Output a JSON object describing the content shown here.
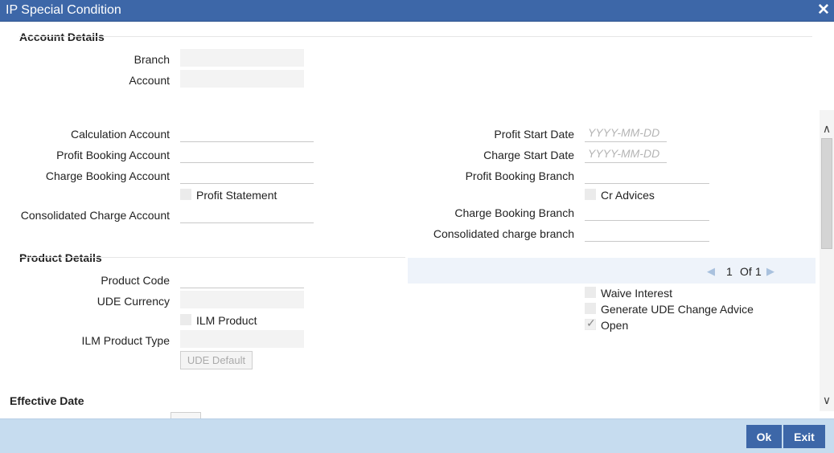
{
  "window": {
    "title": "IP Special Condition",
    "close_symbol": "✕"
  },
  "account_details": {
    "section_title": "Account Details",
    "branch_label": "Branch",
    "branch_value": "",
    "account_label": "Account",
    "account_value": ""
  },
  "accounts": {
    "calculation_account_label": "Calculation Account",
    "profit_booking_account_label": "Profit Booking Account",
    "charge_booking_account_label": "Charge Booking Account",
    "profit_statement_label": "Profit Statement",
    "consolidated_charge_account_label": "Consolidated Charge Account",
    "profit_start_date_label": "Profit Start Date",
    "profit_start_date_placeholder": "YYYY-MM-DD",
    "charge_start_date_label": "Charge Start Date",
    "charge_start_date_placeholder": "YYYY-MM-DD",
    "profit_booking_branch_label": "Profit Booking Branch",
    "cr_advices_label": "Cr Advices",
    "charge_booking_branch_label": "Charge Booking Branch",
    "consolidated_charge_branch_label": "Consolidated charge branch"
  },
  "product_details": {
    "section_title": "Product Details",
    "product_code_label": "Product Code",
    "ude_currency_label": "UDE Currency",
    "ilm_product_label": "ILM Product",
    "ilm_product_type_label": "ILM Product Type",
    "ude_default_button": "UDE Default",
    "pager_page": "1",
    "pager_of": "Of",
    "pager_total": "1",
    "pager_prev": "◀",
    "pager_next": "▶",
    "waive_interest_label": "Waive Interest",
    "generate_ude_change_advice_label": "Generate UDE Change Advice",
    "open_label": "Open",
    "open_checked": true
  },
  "effective_date": {
    "section_title": "Effective Date"
  },
  "scrollbar": {
    "up_arrow": "∧",
    "down_arrow": "∨"
  },
  "footer": {
    "ok_label": "Ok",
    "exit_label": "Exit"
  }
}
